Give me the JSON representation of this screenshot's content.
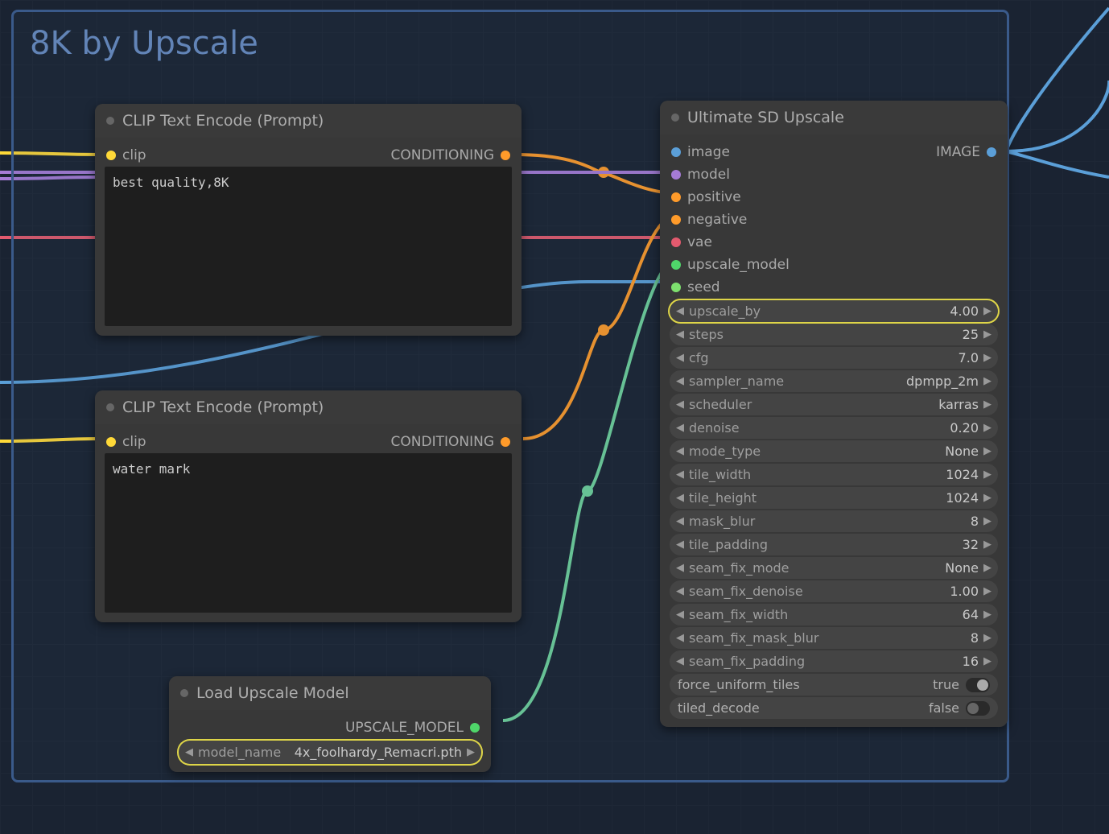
{
  "group": {
    "title": "8K by Upscale"
  },
  "node1": {
    "title": "CLIP Text Encode (Prompt)",
    "input": "clip",
    "output": "CONDITIONING",
    "text": "best quality,8K"
  },
  "node2": {
    "title": "CLIP Text Encode (Prompt)",
    "input": "clip",
    "output": "CONDITIONING",
    "text": "water mark"
  },
  "node3": {
    "title": "Load Upscale Model",
    "output": "UPSCALE_MODEL",
    "param_name": "model_name",
    "param_value": "4x_foolhardy_Remacri.pth"
  },
  "node4": {
    "title": "Ultimate SD Upscale",
    "inputs": [
      "image",
      "model",
      "positive",
      "negative",
      "vae",
      "upscale_model",
      "seed"
    ],
    "output": "IMAGE",
    "params": [
      {
        "name": "upscale_by",
        "value": "4.00",
        "hl": true
      },
      {
        "name": "steps",
        "value": "25"
      },
      {
        "name": "cfg",
        "value": "7.0"
      },
      {
        "name": "sampler_name",
        "value": "dpmpp_2m"
      },
      {
        "name": "scheduler",
        "value": "karras"
      },
      {
        "name": "denoise",
        "value": "0.20"
      },
      {
        "name": "mode_type",
        "value": "None"
      },
      {
        "name": "tile_width",
        "value": "1024"
      },
      {
        "name": "tile_height",
        "value": "1024"
      },
      {
        "name": "mask_blur",
        "value": "8"
      },
      {
        "name": "tile_padding",
        "value": "32"
      },
      {
        "name": "seam_fix_mode",
        "value": "None"
      },
      {
        "name": "seam_fix_denoise",
        "value": "1.00"
      },
      {
        "name": "seam_fix_width",
        "value": "64"
      },
      {
        "name": "seam_fix_mask_blur",
        "value": "8"
      },
      {
        "name": "seam_fix_padding",
        "value": "16"
      }
    ],
    "toggles": [
      {
        "name": "force_uniform_tiles",
        "value": "true",
        "on": true
      },
      {
        "name": "tiled_decode",
        "value": "false",
        "on": false
      }
    ]
  },
  "colors": {
    "clip": "#ffd938",
    "conditioning": "#ff9b2a",
    "image": "#5b9fd8",
    "model": "#a67bd6",
    "vae": "#e35a6e",
    "upscale_model": "#4fd66a",
    "seed": "#7de06e"
  }
}
